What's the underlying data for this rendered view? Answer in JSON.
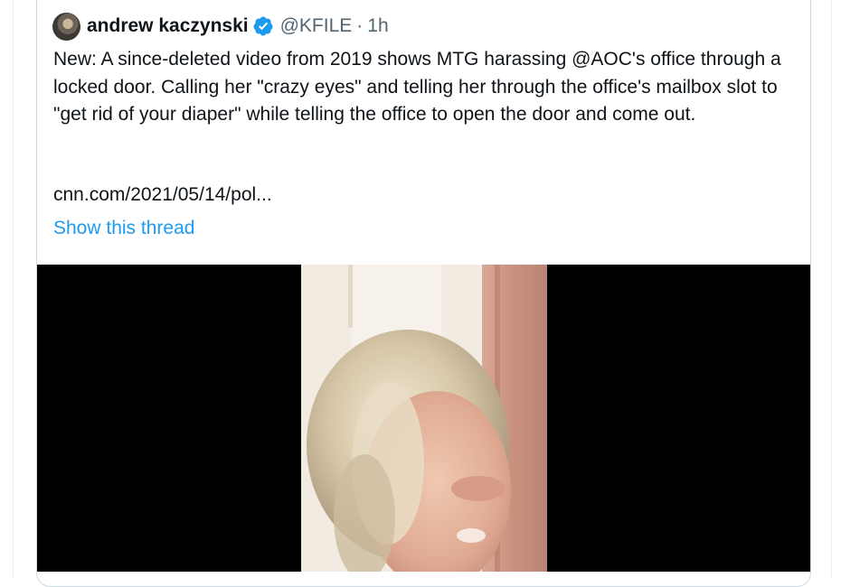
{
  "tweet": {
    "author": {
      "display_name": "andrew kaczynski",
      "handle": "@KFILE",
      "separator": "·",
      "time": "1h",
      "verified": true,
      "avatar_icon": "avatar"
    },
    "text_paragraphs": [
      "New: A since-deleted video from 2019 shows MTG harassing @AOC's office through a locked door. Calling her \"crazy eyes\" and telling her through the office's mailbox slot to \"get rid of your diaper\" while telling the office to open the door and come out."
    ],
    "link_text": "cnn.com/2021/05/14/pol...",
    "show_thread_label": "Show this thread",
    "media_type": "video"
  },
  "colors": {
    "text_primary": "#0f1419",
    "text_secondary": "#536471",
    "accent": "#1d9bf0",
    "border": "#cfd9de",
    "media_background": "#000000"
  },
  "icons": {
    "verified": "verified-badge-icon"
  }
}
